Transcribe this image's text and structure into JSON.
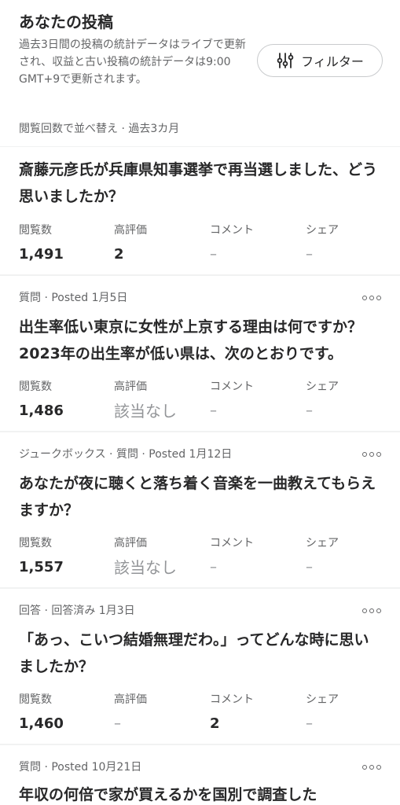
{
  "header": {
    "title": "あなたの投稿",
    "description": "過去3日間の投稿の統計データはライブで更新され、収益と古い投稿の統計データは9:00 GMT+9で更新されます。",
    "filter_label": "フィルター",
    "sort_line": "閲覧回数で並べ替え · 過去3カ月"
  },
  "stat_labels": {
    "views": "閲覧数",
    "upvotes": "高評価",
    "comments": "コメント",
    "shares": "シェア"
  },
  "posts": [
    {
      "meta": "",
      "title": "斎藤元彦氏が兵庫県知事選挙で再当選しました、どう思いましたか？",
      "views": "1,491",
      "upvotes": "2",
      "comments": "–",
      "shares": "–"
    },
    {
      "meta": "質問 · Posted 1月5日",
      "title": "出生率低い東京に女性が上京する理由は何ですか？2023年の出生率が低い県は、次のとおりです。",
      "views": "1,486",
      "upvotes": "該当なし",
      "comments": "–",
      "shares": "–"
    },
    {
      "meta": "ジュークボックス · 質問 · Posted 1月12日",
      "title": "あなたが夜に聴くと落ち着く音楽を一曲教えてもらえますか？",
      "views": "1,557",
      "upvotes": "該当なし",
      "comments": "–",
      "shares": "–"
    },
    {
      "meta": "回答 · 回答済み 1月3日",
      "title": "「あっ、こいつ結婚無理だわ。」ってどんな時に思いましたか？",
      "views": "1,460",
      "upvotes": "–",
      "comments": "2",
      "shares": "–"
    },
    {
      "meta": "質問 · Posted 10月21日",
      "title": "年収の何倍で家が買えるかを国別で調査した"
    }
  ]
}
